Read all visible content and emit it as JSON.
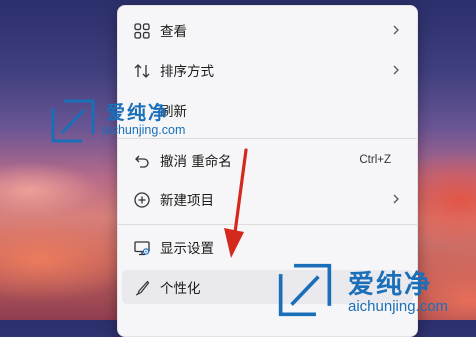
{
  "menu": {
    "items": [
      {
        "label": "查看",
        "icon": "view-grid-icon",
        "submenu": true
      },
      {
        "label": "排序方式",
        "icon": "sort-icon",
        "submenu": true
      },
      {
        "label": "刷新",
        "icon": "refresh-icon",
        "submenu": false
      },
      {
        "label": "撤消 重命名",
        "icon": "undo-icon",
        "shortcut": "Ctrl+Z"
      },
      {
        "label": "新建项目",
        "icon": "new-item-icon",
        "submenu": true
      },
      {
        "label": "显示设置",
        "icon": "display-settings-icon",
        "submenu": false
      },
      {
        "label": "个性化",
        "icon": "personalize-brush-icon",
        "submenu": false
      }
    ]
  },
  "watermark": {
    "title": "爱纯净",
    "url": "aichunjing.com",
    "color": "#1a6fb8"
  },
  "annotation": {
    "arrow_color": "#d42a1e"
  }
}
